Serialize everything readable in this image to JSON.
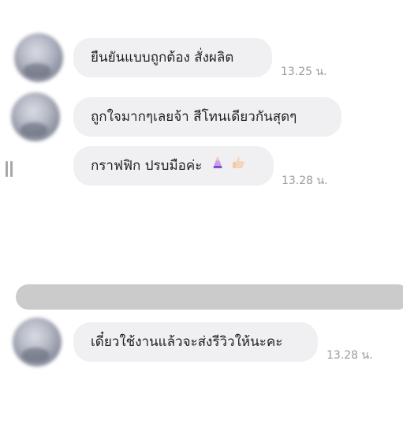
{
  "messages": [
    {
      "text": "ยืนยันแบบถูกต้อง สั่งผลิต",
      "time": "13.25 น."
    },
    {
      "text": "ถูกใจมากๆเลยจ้า สีโทนเดียวกันสุดๆ",
      "time": ""
    },
    {
      "text": "กราฟฟิก ปรบมือค่ะ",
      "time": "13.28 น.",
      "emojis": [
        "raised-hands-icon",
        "thumbs-up-icon"
      ]
    },
    {
      "text": "เดี๋ยวใช้งานแล้วจะส่งรีวิวให้นะคะ",
      "time": "13.28 น."
    }
  ],
  "colors": {
    "bubble": "#f0f0f3",
    "text": "#1f1f1f",
    "time": "#9a9aa0",
    "divider": "#cbcbcb"
  }
}
